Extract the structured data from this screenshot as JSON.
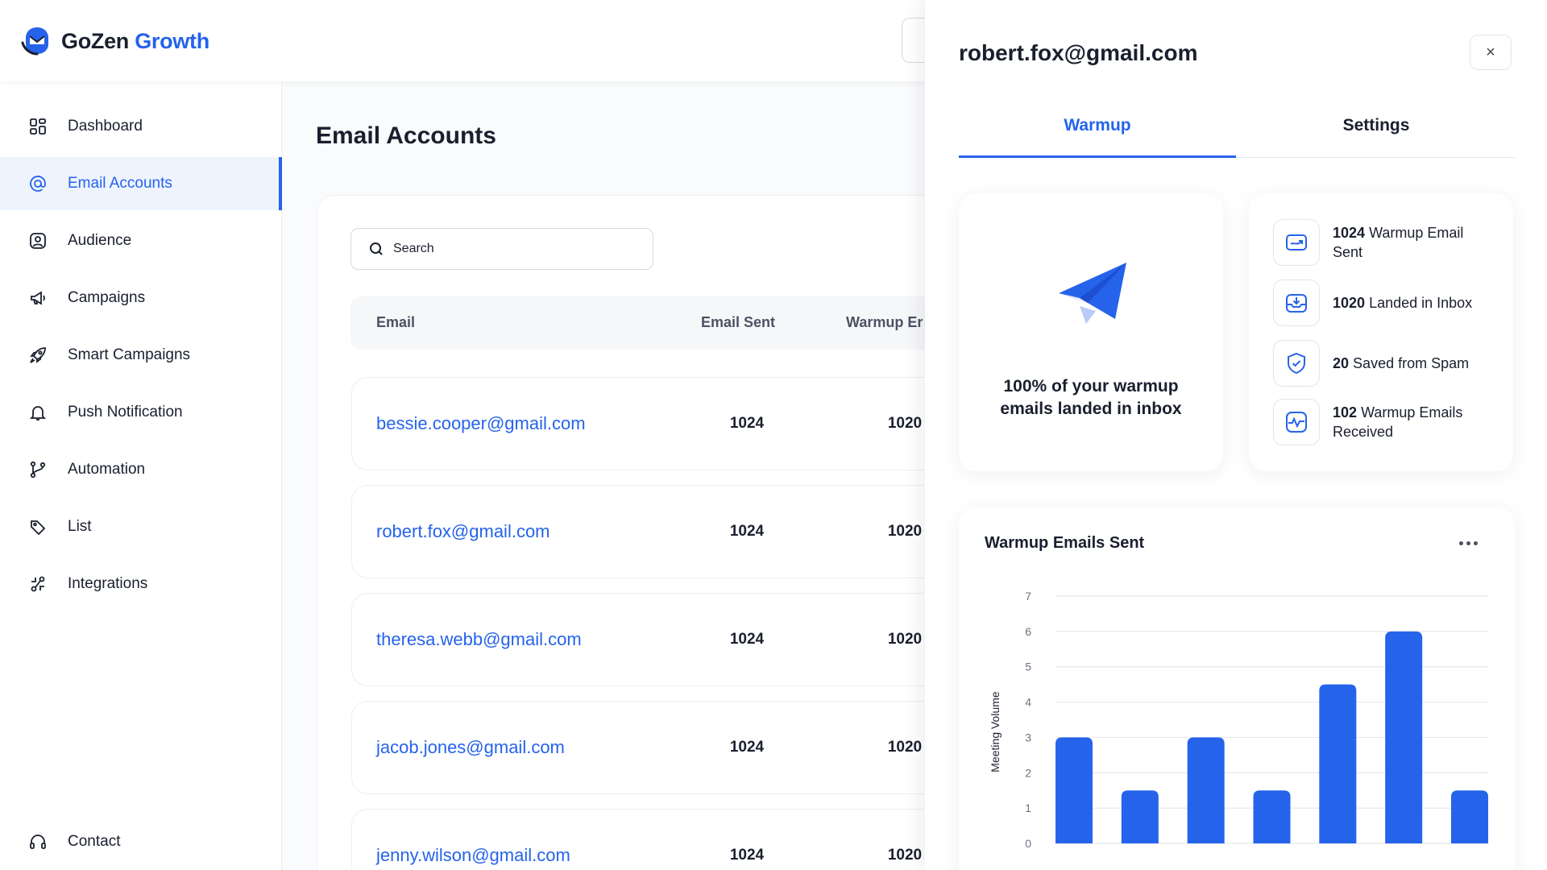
{
  "brand": {
    "name_part1": "GoZen",
    "name_part2": "Growth",
    "accent": "#2563eb"
  },
  "sidebar": {
    "items": [
      {
        "label": "Dashboard",
        "icon": "dashboard-icon",
        "active": false
      },
      {
        "label": "Email Accounts",
        "icon": "at-sign-icon",
        "active": true
      },
      {
        "label": "Audience",
        "icon": "audience-icon",
        "active": false
      },
      {
        "label": "Campaigns",
        "icon": "megaphone-icon",
        "active": false
      },
      {
        "label": "Smart Campaigns",
        "icon": "rocket-icon",
        "active": false
      },
      {
        "label": "Push Notification",
        "icon": "bell-icon",
        "active": false
      },
      {
        "label": "Automation",
        "icon": "branch-icon",
        "active": false
      },
      {
        "label": "List",
        "icon": "tag-icon",
        "active": false
      },
      {
        "label": "Integrations",
        "icon": "integrations-icon",
        "active": false
      },
      {
        "label": "Contact",
        "icon": "headset-icon",
        "active": false
      }
    ]
  },
  "main": {
    "title": "Email Accounts",
    "search_placeholder": "Search",
    "columns": [
      "Email",
      "Email Sent",
      "Warmup Er"
    ],
    "rows": [
      {
        "email": "bessie.cooper@gmail.com",
        "sent": "1024",
        "warmup": "1020"
      },
      {
        "email": "robert.fox@gmail.com",
        "sent": "1024",
        "warmup": "1020"
      },
      {
        "email": "theresa.webb@gmail.com",
        "sent": "1024",
        "warmup": "1020"
      },
      {
        "email": "jacob.jones@gmail.com",
        "sent": "1024",
        "warmup": "1020"
      },
      {
        "email": "jenny.wilson@gmail.com",
        "sent": "1024",
        "warmup": "1020"
      }
    ]
  },
  "drawer": {
    "title": "robert.fox@gmail.com",
    "close_symbol": "×",
    "tabs": [
      "Warmup",
      "Settings"
    ],
    "active_tab": "Warmup",
    "summary_line1": "100% of your warmup",
    "summary_line2": "emails landed in inbox",
    "metrics": [
      {
        "value": "1024",
        "label": "Warmup Email Sent",
        "icon": "mail-sent-icon"
      },
      {
        "value": "1020",
        "label": "Landed in Inbox",
        "icon": "inbox-icon"
      },
      {
        "value": "20",
        "label": "Saved from Spam",
        "icon": "shield-check-icon"
      },
      {
        "value": "102",
        "label": "Warmup Emails Received",
        "icon": "pulse-icon"
      }
    ]
  },
  "chart_data": {
    "type": "bar",
    "title": "Warmup Emails Sent",
    "ylabel": "Meeting Volume",
    "xlabel": "",
    "ylim": [
      0,
      7
    ],
    "yticks": [
      0,
      1,
      2,
      3,
      4,
      5,
      6,
      7
    ],
    "values": [
      3,
      1.5,
      3,
      1.5,
      4.5,
      6,
      1.5
    ],
    "grid": true,
    "bar_color": "#2563eb"
  }
}
